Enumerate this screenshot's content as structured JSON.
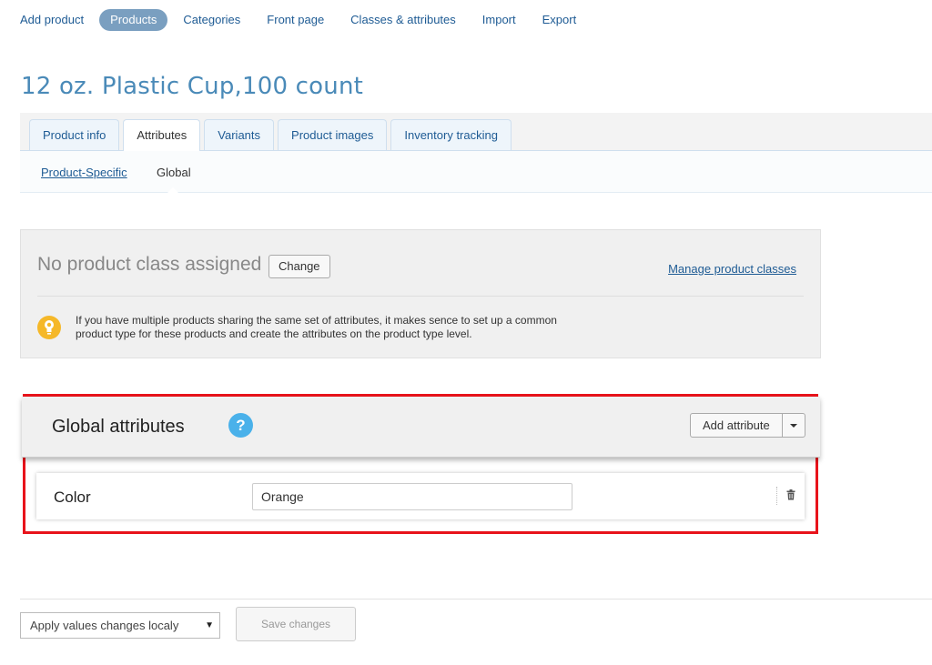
{
  "topnav": {
    "items": [
      {
        "label": "Add product"
      },
      {
        "label": "Products"
      },
      {
        "label": "Categories"
      },
      {
        "label": "Front page"
      },
      {
        "label": "Classes & attributes"
      },
      {
        "label": "Import"
      },
      {
        "label": "Export"
      }
    ],
    "active_index": 1
  },
  "page_title": "12 oz. Plastic Cup,100 count",
  "tabs": [
    {
      "label": "Product info"
    },
    {
      "label": "Attributes"
    },
    {
      "label": "Variants"
    },
    {
      "label": "Product images"
    },
    {
      "label": "Inventory tracking"
    }
  ],
  "active_tab_index": 1,
  "subnav": {
    "product_specific": "Product-Specific",
    "global": "Global"
  },
  "product_class": {
    "status": "No product class assigned",
    "change_label": "Change",
    "manage_link": "Manage product classes",
    "hint_icon": "lightbulb-icon",
    "hint_text": "If you have multiple products sharing the same set of attributes, it makes sence to set up a common product type for these products and create the attributes on the product type level."
  },
  "global_attributes": {
    "title": "Global attributes",
    "help_icon": "question-icon",
    "help_glyph": "?",
    "add_label": "Add attribute",
    "items": [
      {
        "name": "Color",
        "value": "Orange"
      }
    ]
  },
  "footer": {
    "apply_select": "Apply values changes localy",
    "save_label": "Save changes"
  },
  "colors": {
    "link": "#1e5b94",
    "title": "#4a8ab8",
    "active_nav": "#7a9fc0",
    "highlight_frame": "#e8131b",
    "help_icon": "#4ab1ea",
    "hint_icon": "#f5b829"
  }
}
